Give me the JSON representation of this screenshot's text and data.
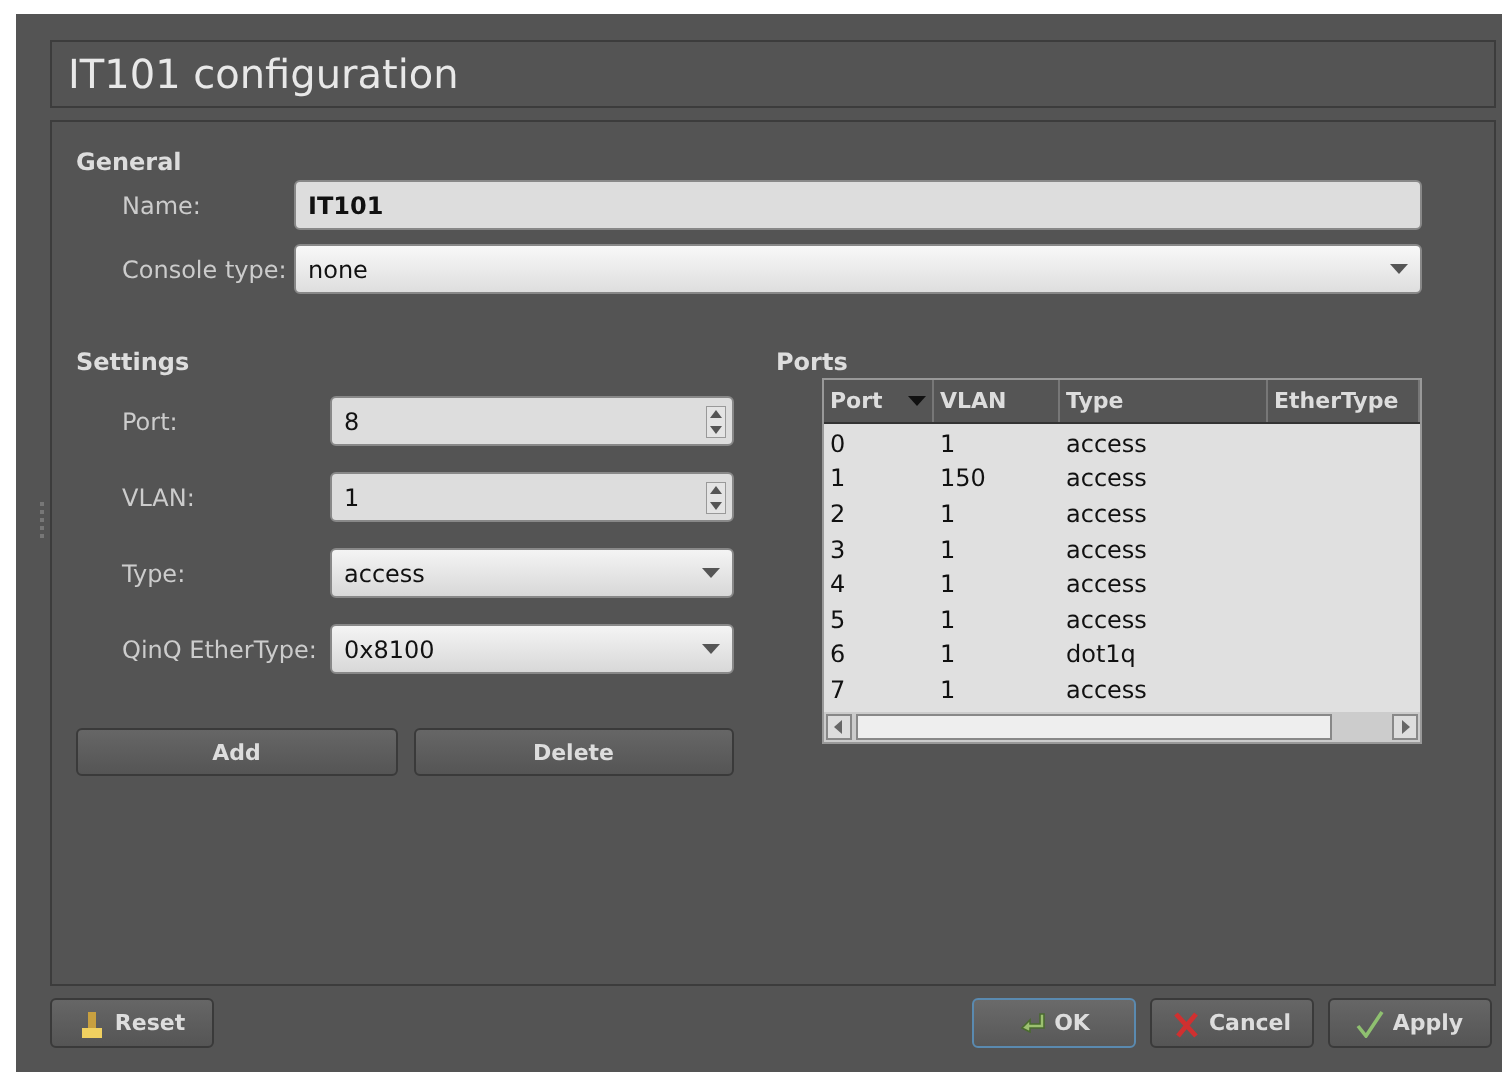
{
  "window": {
    "title": "IT101 configuration"
  },
  "general": {
    "heading": "General",
    "fields": [
      {
        "kind": "text",
        "label": "Name:",
        "value": "IT101"
      },
      {
        "kind": "combo",
        "label": "Console type:",
        "value": "none"
      }
    ]
  },
  "settings": {
    "heading": "Settings",
    "fields": [
      {
        "kind": "spin",
        "label": "Port:",
        "value": "8"
      },
      {
        "kind": "spin",
        "label": "VLAN:",
        "value": "1"
      },
      {
        "kind": "select",
        "label": "Type:",
        "value": "access"
      },
      {
        "kind": "select",
        "label": "QinQ EtherType:",
        "value": "0x8100"
      }
    ],
    "buttons": [
      "Add",
      "Delete"
    ]
  },
  "ports": {
    "heading": "Ports",
    "columns": [
      {
        "label": "Port",
        "sorted": true
      },
      {
        "label": "VLAN",
        "sorted": false
      },
      {
        "label": "Type",
        "sorted": false
      },
      {
        "label": "EtherType",
        "sorted": false
      }
    ],
    "rows": [
      [
        "0",
        "1",
        "access"
      ],
      [
        "1",
        "150",
        "access"
      ],
      [
        "2",
        "1",
        "access"
      ],
      [
        "3",
        "1",
        "access"
      ],
      [
        "4",
        "1",
        "access"
      ],
      [
        "5",
        "1",
        "access"
      ],
      [
        "6",
        "1",
        "dot1q"
      ],
      [
        "7",
        "1",
        "access"
      ]
    ]
  },
  "buttons": [
    {
      "kind": "reset",
      "label": "Reset",
      "default": false
    },
    {
      "kind": "ok",
      "label": "OK",
      "default": true
    },
    {
      "kind": "cancel",
      "label": "Cancel",
      "default": false
    },
    {
      "kind": "apply",
      "label": "Apply",
      "default": false
    }
  ]
}
